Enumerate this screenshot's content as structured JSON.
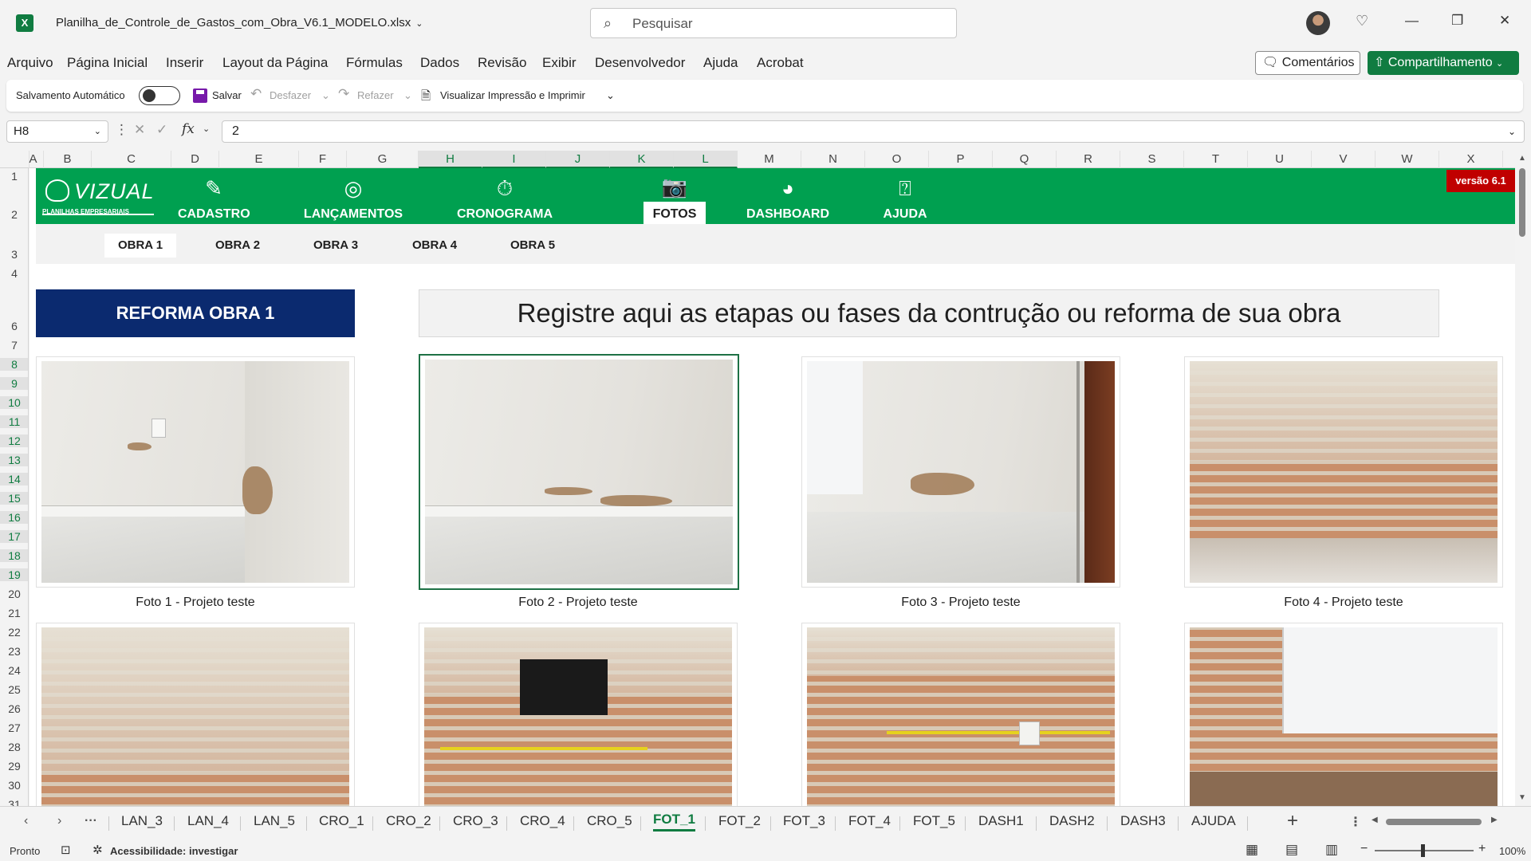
{
  "titlebar": {
    "app_icon": "X",
    "filename": "Planilha_de_Controle_de_Gastos_com_Obra_V6.1_MODELO.xlsx",
    "search_placeholder": "Pesquisar"
  },
  "menu": [
    "Arquivo",
    "Página Inicial",
    "Inserir",
    "Layout da Página",
    "Fórmulas",
    "Dados",
    "Revisão",
    "Exibir",
    "Desenvolvedor",
    "Ajuda",
    "Acrobat"
  ],
  "actions": {
    "comments": "Comentários",
    "share": "Compartilhamento"
  },
  "qat": {
    "autosave": "Salvamento Automático",
    "save": "Salvar",
    "undo": "Desfazer",
    "redo": "Refazer",
    "print": "Visualizar Impressão e Imprimir"
  },
  "formula_bar": {
    "cell_ref": "H8",
    "fx": "fx",
    "value": "2"
  },
  "columns": [
    "A",
    "B",
    "C",
    "D",
    "E",
    "F",
    "G",
    "H",
    "I",
    "J",
    "K",
    "L",
    "M",
    "N",
    "O",
    "P",
    "Q",
    "R",
    "S",
    "T",
    "U",
    "V",
    "W",
    "X"
  ],
  "selected_columns": [
    "H",
    "I",
    "J",
    "K",
    "L"
  ],
  "rows": [
    "1",
    "2",
    "3",
    "4",
    "6",
    "7",
    "8",
    "9",
    "10",
    "11",
    "12",
    "13",
    "14",
    "15",
    "16",
    "17",
    "18",
    "19",
    "20",
    "21",
    "22",
    "23",
    "24",
    "25",
    "26",
    "27",
    "28",
    "29",
    "30",
    "31"
  ],
  "selected_rows": [
    "8",
    "9",
    "10",
    "11",
    "12",
    "13",
    "14",
    "15",
    "16",
    "17",
    "18",
    "19"
  ],
  "banner": {
    "logo": "VIZUAL",
    "logo_sub": "PLANILHAS EMPRESARIAIS",
    "version": "versão 6.1",
    "nav": [
      {
        "label": "CADASTRO",
        "icon": "pencil-icon"
      },
      {
        "label": "LANÇAMENTOS",
        "icon": "target-icon"
      },
      {
        "label": "CRONOGRAMA",
        "icon": "stopwatch-icon"
      },
      {
        "label": "FOTOS",
        "icon": "camera-icon"
      },
      {
        "label": "DASHBOARD",
        "icon": "pie-chart-icon"
      },
      {
        "label": "AJUDA",
        "icon": "help-icon"
      }
    ],
    "active_nav": "FOTOS"
  },
  "obras": [
    "OBRA 1",
    "OBRA 2",
    "OBRA 3",
    "OBRA 4",
    "OBRA 5"
  ],
  "active_obra": "OBRA 1",
  "section_title": "REFORMA OBRA 1",
  "description": "Registre aqui as etapas ou fases da contrução ou reforma de sua obra",
  "photos": [
    {
      "caption": "Foto 1 - Projeto teste"
    },
    {
      "caption": "Foto 2 - Projeto teste"
    },
    {
      "caption": "Foto 3 - Projeto teste"
    },
    {
      "caption": "Foto 4 - Projeto teste"
    }
  ],
  "sheet_tabs": [
    "LAN_3",
    "LAN_4",
    "LAN_5",
    "CRO_1",
    "CRO_2",
    "CRO_3",
    "CRO_4",
    "CRO_5",
    "FOT_1",
    "FOT_2",
    "FOT_3",
    "FOT_4",
    "FOT_5",
    "DASH1",
    "DASH2",
    "DASH3",
    "AJUDA"
  ],
  "active_sheet": "FOT_1",
  "status": {
    "ready": "Pronto",
    "accessibility": "Acessibilidade: investigar",
    "zoom": "100%"
  },
  "colors": {
    "excel_green": "#107c41",
    "banner_green": "#00a050",
    "title_blue": "#0b2a6f",
    "version_red": "#c00000"
  }
}
